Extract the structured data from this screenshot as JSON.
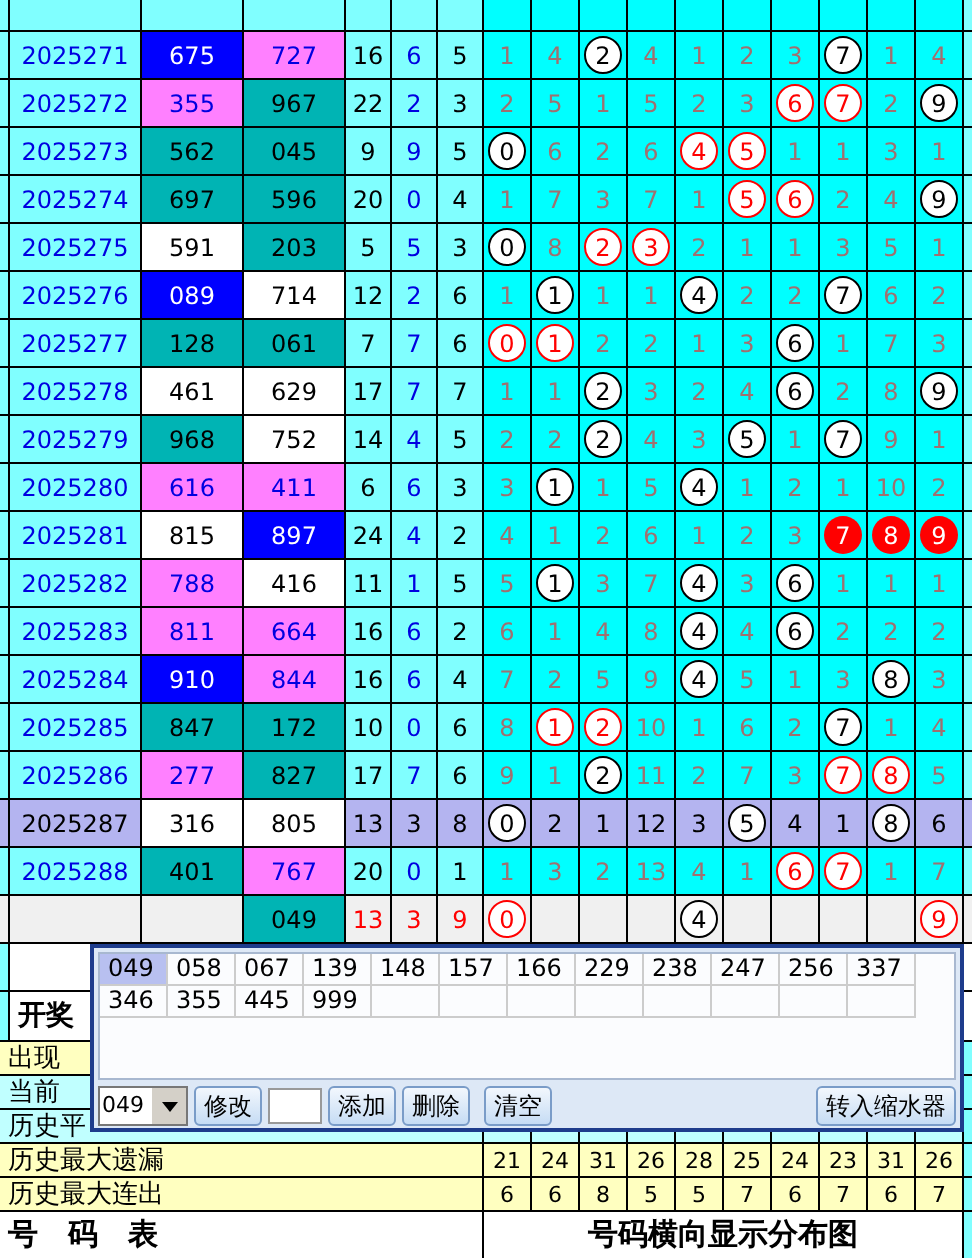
{
  "rows": [
    {
      "issue": "2025271",
      "highlight": false,
      "nums": [
        {
          "text": "675",
          "kind": "blue"
        },
        {
          "text": "727",
          "kind": "pink"
        }
      ],
      "sum": "16",
      "span": "6",
      "tail": "5",
      "digits": [
        {
          "v": "1",
          "kind": "miss"
        },
        {
          "v": "4",
          "kind": "miss"
        },
        {
          "v": "2",
          "kind": "hit"
        },
        {
          "v": "4",
          "kind": "miss"
        },
        {
          "v": "1",
          "kind": "miss"
        },
        {
          "v": "2",
          "kind": "miss"
        },
        {
          "v": "3",
          "kind": "miss"
        },
        {
          "v": "7",
          "kind": "hit"
        },
        {
          "v": "1",
          "kind": "miss"
        },
        {
          "v": "4",
          "kind": "miss"
        }
      ]
    },
    {
      "issue": "2025272",
      "highlight": false,
      "nums": [
        {
          "text": "355",
          "kind": "pink"
        },
        {
          "text": "967",
          "kind": "teal"
        }
      ],
      "sum": "22",
      "span": "2",
      "tail": "3",
      "digits": [
        {
          "v": "2",
          "kind": "miss"
        },
        {
          "v": "5",
          "kind": "miss"
        },
        {
          "v": "1",
          "kind": "miss"
        },
        {
          "v": "5",
          "kind": "miss"
        },
        {
          "v": "2",
          "kind": "miss"
        },
        {
          "v": "3",
          "kind": "miss"
        },
        {
          "v": "6",
          "kind": "hot"
        },
        {
          "v": "7",
          "kind": "hot"
        },
        {
          "v": "2",
          "kind": "miss"
        },
        {
          "v": "9",
          "kind": "hit"
        }
      ]
    },
    {
      "issue": "2025273",
      "highlight": false,
      "nums": [
        {
          "text": "562",
          "kind": "teal"
        },
        {
          "text": "045",
          "kind": "teal"
        }
      ],
      "sum": "9",
      "span": "9",
      "tail": "5",
      "digits": [
        {
          "v": "0",
          "kind": "hit"
        },
        {
          "v": "6",
          "kind": "miss"
        },
        {
          "v": "2",
          "kind": "miss"
        },
        {
          "v": "6",
          "kind": "miss"
        },
        {
          "v": "4",
          "kind": "hot"
        },
        {
          "v": "5",
          "kind": "hot"
        },
        {
          "v": "1",
          "kind": "miss"
        },
        {
          "v": "1",
          "kind": "miss"
        },
        {
          "v": "3",
          "kind": "miss"
        },
        {
          "v": "1",
          "kind": "miss"
        }
      ]
    },
    {
      "issue": "2025274",
      "highlight": false,
      "nums": [
        {
          "text": "697",
          "kind": "teal"
        },
        {
          "text": "596",
          "kind": "teal"
        }
      ],
      "sum": "20",
      "span": "0",
      "tail": "4",
      "digits": [
        {
          "v": "1",
          "kind": "miss"
        },
        {
          "v": "7",
          "kind": "miss"
        },
        {
          "v": "3",
          "kind": "miss"
        },
        {
          "v": "7",
          "kind": "miss"
        },
        {
          "v": "1",
          "kind": "miss"
        },
        {
          "v": "5",
          "kind": "hot"
        },
        {
          "v": "6",
          "kind": "hot"
        },
        {
          "v": "2",
          "kind": "miss"
        },
        {
          "v": "4",
          "kind": "miss"
        },
        {
          "v": "9",
          "kind": "hit"
        }
      ]
    },
    {
      "issue": "2025275",
      "highlight": false,
      "nums": [
        {
          "text": "591",
          "kind": "plain"
        },
        {
          "text": "203",
          "kind": "teal"
        }
      ],
      "sum": "5",
      "span": "5",
      "tail": "3",
      "digits": [
        {
          "v": "0",
          "kind": "hit"
        },
        {
          "v": "8",
          "kind": "miss"
        },
        {
          "v": "2",
          "kind": "hot"
        },
        {
          "v": "3",
          "kind": "hot"
        },
        {
          "v": "2",
          "kind": "miss"
        },
        {
          "v": "1",
          "kind": "miss"
        },
        {
          "v": "1",
          "kind": "miss"
        },
        {
          "v": "3",
          "kind": "miss"
        },
        {
          "v": "5",
          "kind": "miss"
        },
        {
          "v": "1",
          "kind": "miss"
        }
      ]
    },
    {
      "issue": "2025276",
      "highlight": false,
      "nums": [
        {
          "text": "089",
          "kind": "blue"
        },
        {
          "text": "714",
          "kind": "plain"
        }
      ],
      "sum": "12",
      "span": "2",
      "tail": "6",
      "digits": [
        {
          "v": "1",
          "kind": "miss"
        },
        {
          "v": "1",
          "kind": "hit"
        },
        {
          "v": "1",
          "kind": "miss"
        },
        {
          "v": "1",
          "kind": "miss"
        },
        {
          "v": "4",
          "kind": "hit"
        },
        {
          "v": "2",
          "kind": "miss"
        },
        {
          "v": "2",
          "kind": "miss"
        },
        {
          "v": "7",
          "kind": "hit"
        },
        {
          "v": "6",
          "kind": "miss"
        },
        {
          "v": "2",
          "kind": "miss"
        }
      ]
    },
    {
      "issue": "2025277",
      "highlight": false,
      "nums": [
        {
          "text": "128",
          "kind": "teal"
        },
        {
          "text": "061",
          "kind": "teal"
        }
      ],
      "sum": "7",
      "span": "7",
      "tail": "6",
      "digits": [
        {
          "v": "0",
          "kind": "hot"
        },
        {
          "v": "1",
          "kind": "hot"
        },
        {
          "v": "2",
          "kind": "miss"
        },
        {
          "v": "2",
          "kind": "miss"
        },
        {
          "v": "1",
          "kind": "miss"
        },
        {
          "v": "3",
          "kind": "miss"
        },
        {
          "v": "6",
          "kind": "hit"
        },
        {
          "v": "1",
          "kind": "miss"
        },
        {
          "v": "7",
          "kind": "miss"
        },
        {
          "v": "3",
          "kind": "miss"
        }
      ]
    },
    {
      "issue": "2025278",
      "highlight": false,
      "nums": [
        {
          "text": "461",
          "kind": "plain"
        },
        {
          "text": "629",
          "kind": "plain"
        }
      ],
      "sum": "17",
      "span": "7",
      "tail": "7",
      "digits": [
        {
          "v": "1",
          "kind": "miss"
        },
        {
          "v": "1",
          "kind": "miss"
        },
        {
          "v": "2",
          "kind": "hit"
        },
        {
          "v": "3",
          "kind": "miss"
        },
        {
          "v": "2",
          "kind": "miss"
        },
        {
          "v": "4",
          "kind": "miss"
        },
        {
          "v": "6",
          "kind": "hit"
        },
        {
          "v": "2",
          "kind": "miss"
        },
        {
          "v": "8",
          "kind": "miss"
        },
        {
          "v": "9",
          "kind": "hit"
        }
      ]
    },
    {
      "issue": "2025279",
      "highlight": false,
      "nums": [
        {
          "text": "968",
          "kind": "teal"
        },
        {
          "text": "752",
          "kind": "plain"
        }
      ],
      "sum": "14",
      "span": "4",
      "tail": "5",
      "digits": [
        {
          "v": "2",
          "kind": "miss"
        },
        {
          "v": "2",
          "kind": "miss"
        },
        {
          "v": "2",
          "kind": "hit"
        },
        {
          "v": "4",
          "kind": "miss"
        },
        {
          "v": "3",
          "kind": "miss"
        },
        {
          "v": "5",
          "kind": "hit"
        },
        {
          "v": "1",
          "kind": "miss"
        },
        {
          "v": "7",
          "kind": "hit"
        },
        {
          "v": "9",
          "kind": "miss"
        },
        {
          "v": "1",
          "kind": "miss"
        }
      ]
    },
    {
      "issue": "2025280",
      "highlight": false,
      "nums": [
        {
          "text": "616",
          "kind": "pink"
        },
        {
          "text": "411",
          "kind": "pink"
        }
      ],
      "sum": "6",
      "span": "6",
      "tail": "3",
      "digits": [
        {
          "v": "3",
          "kind": "miss"
        },
        {
          "v": "1",
          "kind": "hit"
        },
        {
          "v": "1",
          "kind": "miss"
        },
        {
          "v": "5",
          "kind": "miss"
        },
        {
          "v": "4",
          "kind": "hit"
        },
        {
          "v": "1",
          "kind": "miss"
        },
        {
          "v": "2",
          "kind": "miss"
        },
        {
          "v": "1",
          "kind": "miss"
        },
        {
          "v": "10",
          "kind": "miss"
        },
        {
          "v": "2",
          "kind": "miss"
        }
      ]
    },
    {
      "issue": "2025281",
      "highlight": false,
      "nums": [
        {
          "text": "815",
          "kind": "plain"
        },
        {
          "text": "897",
          "kind": "blue"
        }
      ],
      "sum": "24",
      "span": "4",
      "tail": "2",
      "digits": [
        {
          "v": "4",
          "kind": "miss"
        },
        {
          "v": "1",
          "kind": "miss"
        },
        {
          "v": "2",
          "kind": "miss"
        },
        {
          "v": "6",
          "kind": "miss"
        },
        {
          "v": "1",
          "kind": "miss"
        },
        {
          "v": "2",
          "kind": "miss"
        },
        {
          "v": "3",
          "kind": "miss"
        },
        {
          "v": "7",
          "kind": "fill"
        },
        {
          "v": "8",
          "kind": "fill"
        },
        {
          "v": "9",
          "kind": "fill"
        }
      ]
    },
    {
      "issue": "2025282",
      "highlight": false,
      "nums": [
        {
          "text": "788",
          "kind": "pink"
        },
        {
          "text": "416",
          "kind": "plain"
        }
      ],
      "sum": "11",
      "span": "1",
      "tail": "5",
      "digits": [
        {
          "v": "5",
          "kind": "miss"
        },
        {
          "v": "1",
          "kind": "hit"
        },
        {
          "v": "3",
          "kind": "miss"
        },
        {
          "v": "7",
          "kind": "miss"
        },
        {
          "v": "4",
          "kind": "hit"
        },
        {
          "v": "3",
          "kind": "miss"
        },
        {
          "v": "6",
          "kind": "hit"
        },
        {
          "v": "1",
          "kind": "miss"
        },
        {
          "v": "1",
          "kind": "miss"
        },
        {
          "v": "1",
          "kind": "miss"
        }
      ]
    },
    {
      "issue": "2025283",
      "highlight": false,
      "nums": [
        {
          "text": "811",
          "kind": "pink"
        },
        {
          "text": "664",
          "kind": "pink"
        }
      ],
      "sum": "16",
      "span": "6",
      "tail": "2",
      "digits": [
        {
          "v": "6",
          "kind": "miss"
        },
        {
          "v": "1",
          "kind": "miss"
        },
        {
          "v": "4",
          "kind": "miss"
        },
        {
          "v": "8",
          "kind": "miss"
        },
        {
          "v": "4",
          "kind": "hit"
        },
        {
          "v": "4",
          "kind": "miss"
        },
        {
          "v": "6",
          "kind": "hit"
        },
        {
          "v": "2",
          "kind": "miss"
        },
        {
          "v": "2",
          "kind": "miss"
        },
        {
          "v": "2",
          "kind": "miss"
        }
      ]
    },
    {
      "issue": "2025284",
      "highlight": false,
      "nums": [
        {
          "text": "910",
          "kind": "blue"
        },
        {
          "text": "844",
          "kind": "pink"
        }
      ],
      "sum": "16",
      "span": "6",
      "tail": "4",
      "digits": [
        {
          "v": "7",
          "kind": "miss"
        },
        {
          "v": "2",
          "kind": "miss"
        },
        {
          "v": "5",
          "kind": "miss"
        },
        {
          "v": "9",
          "kind": "miss"
        },
        {
          "v": "4",
          "kind": "hit"
        },
        {
          "v": "5",
          "kind": "miss"
        },
        {
          "v": "1",
          "kind": "miss"
        },
        {
          "v": "3",
          "kind": "miss"
        },
        {
          "v": "8",
          "kind": "hit"
        },
        {
          "v": "3",
          "kind": "miss"
        }
      ]
    },
    {
      "issue": "2025285",
      "highlight": false,
      "nums": [
        {
          "text": "847",
          "kind": "teal"
        },
        {
          "text": "172",
          "kind": "teal"
        }
      ],
      "sum": "10",
      "span": "0",
      "tail": "6",
      "digits": [
        {
          "v": "8",
          "kind": "miss"
        },
        {
          "v": "1",
          "kind": "hot"
        },
        {
          "v": "2",
          "kind": "hot"
        },
        {
          "v": "10",
          "kind": "miss"
        },
        {
          "v": "1",
          "kind": "miss"
        },
        {
          "v": "6",
          "kind": "miss"
        },
        {
          "v": "2",
          "kind": "miss"
        },
        {
          "v": "7",
          "kind": "hit"
        },
        {
          "v": "1",
          "kind": "miss"
        },
        {
          "v": "4",
          "kind": "miss"
        }
      ]
    },
    {
      "issue": "2025286",
      "highlight": false,
      "nums": [
        {
          "text": "277",
          "kind": "pink"
        },
        {
          "text": "827",
          "kind": "teal"
        }
      ],
      "sum": "17",
      "span": "7",
      "tail": "6",
      "digits": [
        {
          "v": "9",
          "kind": "miss"
        },
        {
          "v": "1",
          "kind": "miss"
        },
        {
          "v": "2",
          "kind": "hit"
        },
        {
          "v": "11",
          "kind": "miss"
        },
        {
          "v": "2",
          "kind": "miss"
        },
        {
          "v": "7",
          "kind": "miss"
        },
        {
          "v": "3",
          "kind": "miss"
        },
        {
          "v": "7",
          "kind": "hot"
        },
        {
          "v": "8",
          "kind": "hot"
        },
        {
          "v": "5",
          "kind": "miss"
        }
      ]
    },
    {
      "issue": "2025287",
      "highlight": true,
      "nums": [
        {
          "text": "316",
          "kind": "plain"
        },
        {
          "text": "805",
          "kind": "plain"
        }
      ],
      "sum": "13",
      "span": "3",
      "tail": "8",
      "digits": [
        {
          "v": "0",
          "kind": "hit"
        },
        {
          "v": "2",
          "kind": "miss"
        },
        {
          "v": "1",
          "kind": "miss"
        },
        {
          "v": "12",
          "kind": "miss"
        },
        {
          "v": "3",
          "kind": "miss"
        },
        {
          "v": "5",
          "kind": "hit"
        },
        {
          "v": "4",
          "kind": "miss"
        },
        {
          "v": "1",
          "kind": "miss"
        },
        {
          "v": "8",
          "kind": "hit"
        },
        {
          "v": "6",
          "kind": "miss"
        }
      ]
    },
    {
      "issue": "2025288",
      "highlight": false,
      "nums": [
        {
          "text": "401",
          "kind": "teal"
        },
        {
          "text": "767",
          "kind": "pink"
        }
      ],
      "sum": "20",
      "span": "0",
      "tail": "1",
      "digits": [
        {
          "v": "1",
          "kind": "miss"
        },
        {
          "v": "3",
          "kind": "miss"
        },
        {
          "v": "2",
          "kind": "miss"
        },
        {
          "v": "13",
          "kind": "miss"
        },
        {
          "v": "4",
          "kind": "miss"
        },
        {
          "v": "1",
          "kind": "miss"
        },
        {
          "v": "6",
          "kind": "hot"
        },
        {
          "v": "7",
          "kind": "hot"
        },
        {
          "v": "1",
          "kind": "miss"
        },
        {
          "v": "7",
          "kind": "miss"
        }
      ]
    }
  ],
  "summary": {
    "number": {
      "text": "049",
      "kind": "teal"
    },
    "sum": "13",
    "span": "3",
    "tail": "9",
    "digits": [
      {
        "v": "0",
        "kind": "hot"
      },
      {
        "kind": "empty"
      },
      {
        "kind": "empty"
      },
      {
        "kind": "empty"
      },
      {
        "v": "4",
        "kind": "hit"
      },
      {
        "kind": "empty"
      },
      {
        "kind": "empty"
      },
      {
        "kind": "empty"
      },
      {
        "kind": "empty"
      },
      {
        "v": "9",
        "kind": "hot"
      }
    ]
  },
  "header_label": "开奖",
  "stats": [
    {
      "label": "出现",
      "color": "#ffffc0"
    },
    {
      "label": "当前",
      "color": "#c0ffff"
    },
    {
      "label": "历史平",
      "color": "#c0ffff"
    },
    {
      "label": "历史最大遗漏",
      "color": "#ffffc0",
      "values": [
        "21",
        "24",
        "31",
        "26",
        "28",
        "25",
        "24",
        "23",
        "31",
        "26"
      ]
    },
    {
      "label": "历史最大连出",
      "color": "#ffffc0",
      "values": [
        "6",
        "6",
        "8",
        "5",
        "5",
        "7",
        "6",
        "7",
        "6",
        "7"
      ]
    }
  ],
  "footer": [
    "号　码　表",
    "号码横向显示分布图"
  ],
  "popup": {
    "items": [
      {
        "text": "049",
        "selected": true
      },
      {
        "text": "058",
        "selected": false
      },
      {
        "text": "067",
        "selected": false
      },
      {
        "text": "139",
        "selected": false
      },
      {
        "text": "148",
        "selected": false
      },
      {
        "text": "157",
        "selected": false
      },
      {
        "text": "166",
        "selected": false
      },
      {
        "text": "229",
        "selected": false
      },
      {
        "text": "238",
        "selected": false
      },
      {
        "text": "247",
        "selected": false
      },
      {
        "text": "256",
        "selected": false
      },
      {
        "text": "337",
        "selected": false
      },
      {
        "text": "346",
        "selected": false
      },
      {
        "text": "355",
        "selected": false
      },
      {
        "text": "445",
        "selected": false
      },
      {
        "text": "999",
        "selected": false
      }
    ],
    "select_value": "049",
    "buttons": [
      "修改",
      "添加",
      "删除",
      "清空"
    ],
    "transfer_button": "转入缩水器"
  }
}
